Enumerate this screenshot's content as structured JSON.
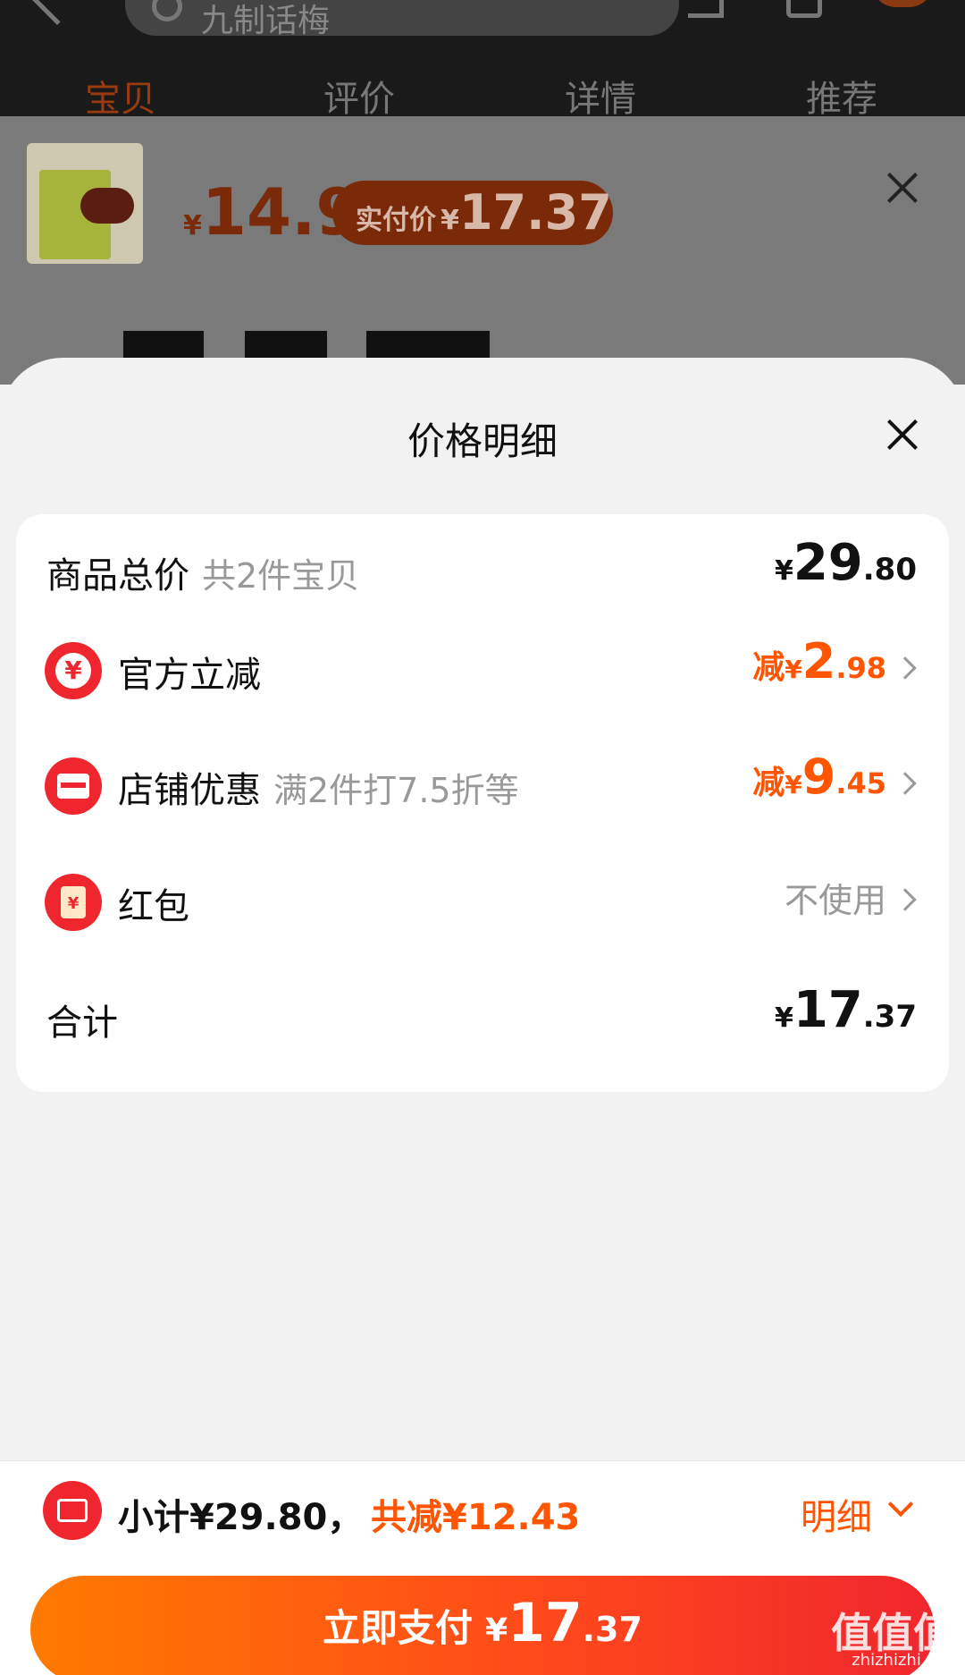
{
  "background": {
    "search_text": "九制话梅",
    "tabs": [
      "宝贝",
      "评价",
      "详情",
      "推荐"
    ],
    "product_price_symbol": "¥",
    "product_price": "14.9",
    "actual_pay_label": "实付价",
    "actual_pay_symbol": "¥",
    "actual_pay_value": "17.37"
  },
  "sheet": {
    "title": "价格明细",
    "rows": [
      {
        "label": "商品总价",
        "sub": "共2件宝贝",
        "currency": "¥",
        "int": "29",
        "dec": ".80"
      },
      {
        "label": "官方立减",
        "prefix": "减",
        "currency": "¥",
        "int": "2",
        "dec": ".98"
      },
      {
        "label": "店铺优惠",
        "sub": "满2件打7.5折等",
        "prefix": "减",
        "currency": "¥",
        "int": "9",
        "dec": ".45"
      },
      {
        "label": "红包",
        "value": "不使用"
      },
      {
        "label": "合计",
        "currency": "¥",
        "int": "17",
        "dec": ".37"
      }
    ]
  },
  "bottom": {
    "subtotal": "小计¥29.80，",
    "reduction": "共减¥12.43",
    "detail_label": "明细",
    "pay_label": "立即支付",
    "pay_currency": "¥",
    "pay_int": "17",
    "pay_dec": ".37"
  },
  "watermark": {
    "logo": "值值值",
    "url": "zhizhizhi.com"
  },
  "colors": {
    "accent": "#ff5400",
    "red": "#f0262e"
  }
}
